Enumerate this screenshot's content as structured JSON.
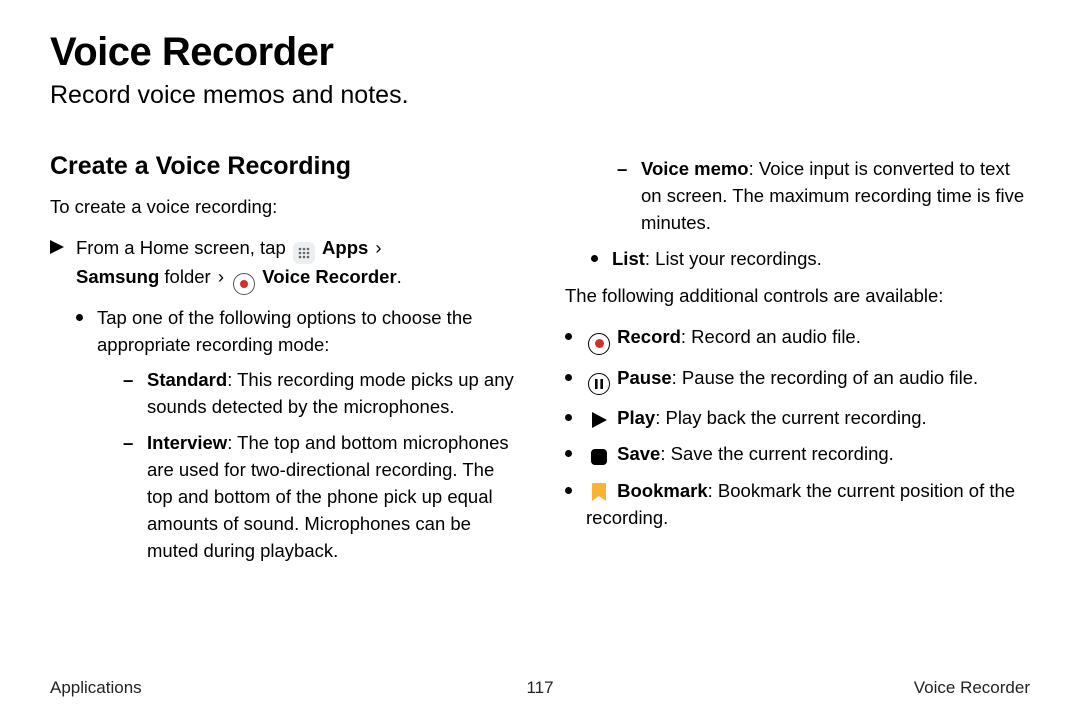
{
  "title": "Voice Recorder",
  "subtitle": "Record voice memos and notes.",
  "section_heading": "Create a Voice Recording",
  "intro": "To create a voice recording:",
  "step_prefix": "From a Home screen, tap ",
  "apps_label": "Apps",
  "samsung_folder": "Samsung",
  "folder_word": " folder",
  "voice_recorder_label": "Voice Recorder",
  "mode_prompt": "Tap one of the following options to choose the appropriate recording mode:",
  "modes": {
    "standard_label": "Standard",
    "standard_desc": ": This recording mode picks up any sounds detected by the microphones.",
    "interview_label": "Interview",
    "interview_desc": ": The top and bottom microphones are used for two-directional recording. The top and bottom of the phone pick up equal amounts of sound. Microphones can be muted during playback.",
    "voicememo_label": "Voice memo",
    "voicememo_desc": ": Voice input is converted to text on screen. The maximum recording time is five minutes."
  },
  "list_label": "List",
  "list_desc": ": List your recordings.",
  "controls_intro": "The following additional controls are available:",
  "controls": {
    "record_label": "Record",
    "record_desc": ": Record an audio file.",
    "pause_label": "Pause",
    "pause_desc": ": Pause the recording of an audio file.",
    "play_label": "Play",
    "play_desc": ": Play back the current recording.",
    "save_label": "Save",
    "save_desc": ": Save the current recording.",
    "bookmark_label": "Bookmark",
    "bookmark_desc": ": Bookmark the current position of the recording."
  },
  "footer": {
    "left": "Applications",
    "page": "117",
    "right": "Voice Recorder"
  }
}
